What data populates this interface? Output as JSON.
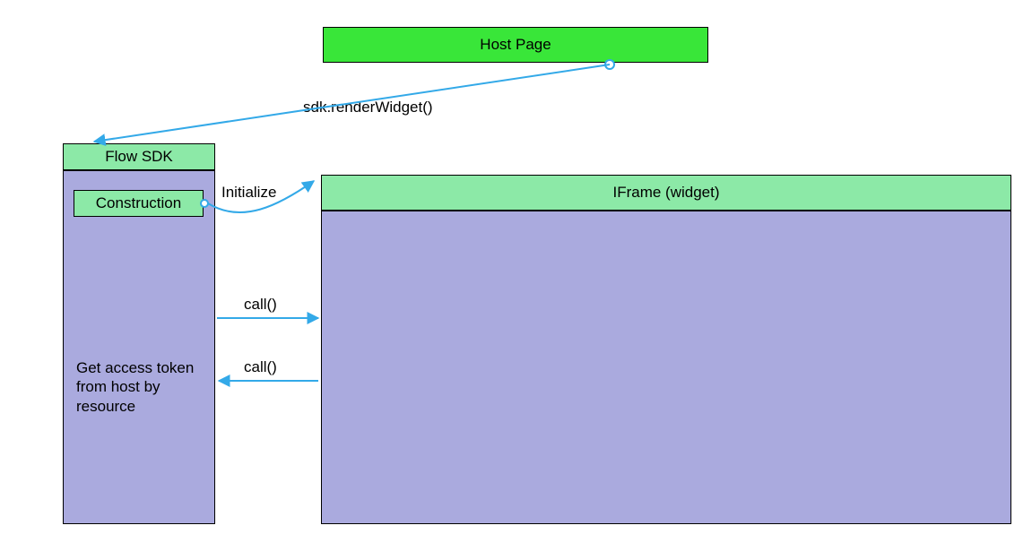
{
  "colors": {
    "green_bright": "#39E639",
    "green_light": "#8CE9A7",
    "purple": "#AAAADE",
    "arrow": "#33A9E8",
    "text": "#000000"
  },
  "boxes": {
    "host_page": "Host Page",
    "flow_sdk": "Flow SDK",
    "construction": "Construction",
    "iframe": "IFrame (widget)"
  },
  "labels": {
    "render": "sdk.renderWidget()",
    "initialize": "Initialize",
    "call1": "call()",
    "call2": "call()",
    "token_text": "Get access token from host by resource"
  }
}
